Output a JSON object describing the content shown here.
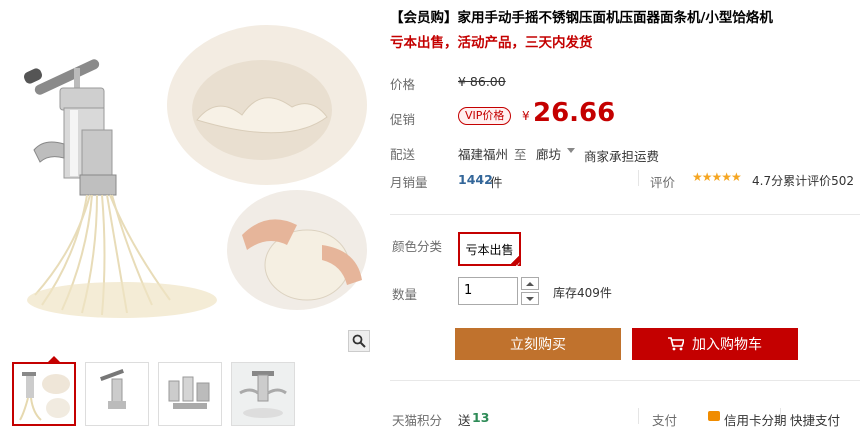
{
  "product": {
    "title": "【会员购】家用手动手摇不锈钢压面机压面器面条机/小型饸烙机",
    "subtitle": "亏本出售，活动产品，三天内发货"
  },
  "price": {
    "label": "价格",
    "original": "¥ 86.00"
  },
  "promo": {
    "label": "促销",
    "vip_tag": "VIP价格",
    "currency": "¥",
    "value": "26.66"
  },
  "shipping": {
    "label": "配送",
    "from": "福建福州",
    "to_word": "至",
    "dest": "廊坊",
    "fee": "商家承担运费"
  },
  "sales": {
    "label": "月销量",
    "count": "1442",
    "unit": "件",
    "rating_label": "评价",
    "stars": "★★★★★",
    "rating_text": "4.7分累计评价502"
  },
  "sku": {
    "label": "颜色分类",
    "selected": "亏本出售"
  },
  "quantity": {
    "label": "数量",
    "value": "1",
    "stock": "库存409件"
  },
  "actions": {
    "buy": "立刻购买",
    "cart": "加入购物车"
  },
  "bottom": {
    "points_label": "天猫积分",
    "points_send": "送",
    "points_value": "13",
    "pay_label": "支付",
    "installment": "信用卡分期",
    "fast_pay": "快捷支付"
  },
  "colors": {
    "accent": "#c40000",
    "buy_button": "#c0722d",
    "link_blue": "#336699",
    "star": "#f5a623"
  }
}
